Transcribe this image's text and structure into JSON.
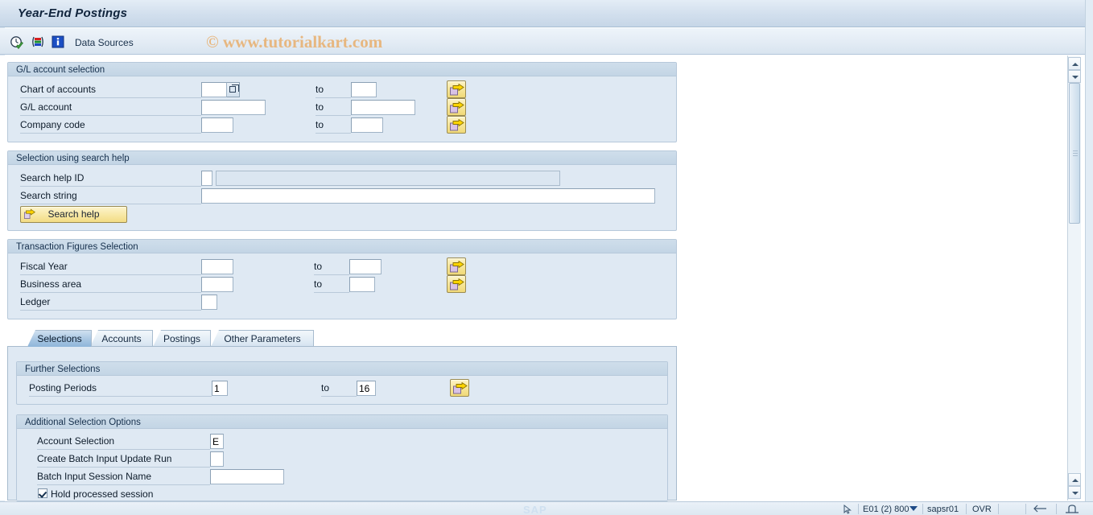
{
  "window": {
    "title": "Year-End Postings"
  },
  "toolbar": {
    "icons": [
      {
        "name": "execute-clock-icon",
        "glyph": "clock-check"
      },
      {
        "name": "multiple-selection-icon",
        "glyph": "color-bars"
      },
      {
        "name": "information-icon",
        "glyph": "info"
      }
    ],
    "data_sources_label": "Data Sources",
    "watermark": "© www.tutorialkart.com"
  },
  "groups": {
    "gl_account_selection": {
      "title": "G/L account selection",
      "rows": [
        {
          "label": "Chart of accounts",
          "value": "",
          "to_label": "to",
          "to_value": "",
          "has_f4": true,
          "multi": true
        },
        {
          "label": "G/L account",
          "value": "",
          "to_label": "to",
          "to_value": "",
          "has_f4": false,
          "multi": true
        },
        {
          "label": "Company code",
          "value": "",
          "to_label": "to",
          "to_value": "",
          "has_f4": false,
          "multi": true
        }
      ]
    },
    "search_help_selection": {
      "title": "Selection using search help",
      "search_help_id_label": "Search help ID",
      "search_help_id_value": "",
      "search_help_id_text": "",
      "search_string_label": "Search string",
      "search_string_value": "",
      "search_help_button": "Search help"
    },
    "transaction_figures": {
      "title": "Transaction Figures Selection",
      "rows": [
        {
          "label": "Fiscal Year",
          "value": "",
          "to_label": "to",
          "to_value": "",
          "multi": true
        },
        {
          "label": "Business area",
          "value": "",
          "to_label": "to",
          "to_value": "",
          "multi": true
        },
        {
          "label": "Ledger",
          "value": "",
          "to_label": "",
          "to_value": "",
          "multi": false
        }
      ]
    }
  },
  "tabs": [
    {
      "label": "Selections",
      "active": true
    },
    {
      "label": "Accounts",
      "active": false
    },
    {
      "label": "Postings",
      "active": false
    },
    {
      "label": "Other Parameters",
      "active": false
    }
  ],
  "tab_content": {
    "further_selections": {
      "title": "Further Selections",
      "posting_periods_label": "Posting Periods",
      "posting_periods_from": "1",
      "to_label": "to",
      "posting_periods_to": "16"
    },
    "additional_selection_options": {
      "title": "Additional Selection Options",
      "account_selection_label": "Account Selection",
      "account_selection_value": "E",
      "create_batch_label": "Create Batch Input Update Run",
      "create_batch_value": "",
      "batch_session_label": "Batch Input Session Name",
      "batch_session_value": "",
      "hold_session_label": "Hold processed session",
      "hold_session_checked": true
    }
  },
  "statusbar": {
    "system": "E01 (2) 800",
    "server": "sapsr01",
    "mode": "OVR",
    "logo": "SAP"
  },
  "colors": {
    "title_text": "#10243c",
    "group_bg": "#dfe9f3",
    "group_header": "#c3d5e5",
    "accent_button": "#f2dc84",
    "active_tab": "#a8c6e2",
    "watermark": "#e8b57a"
  }
}
